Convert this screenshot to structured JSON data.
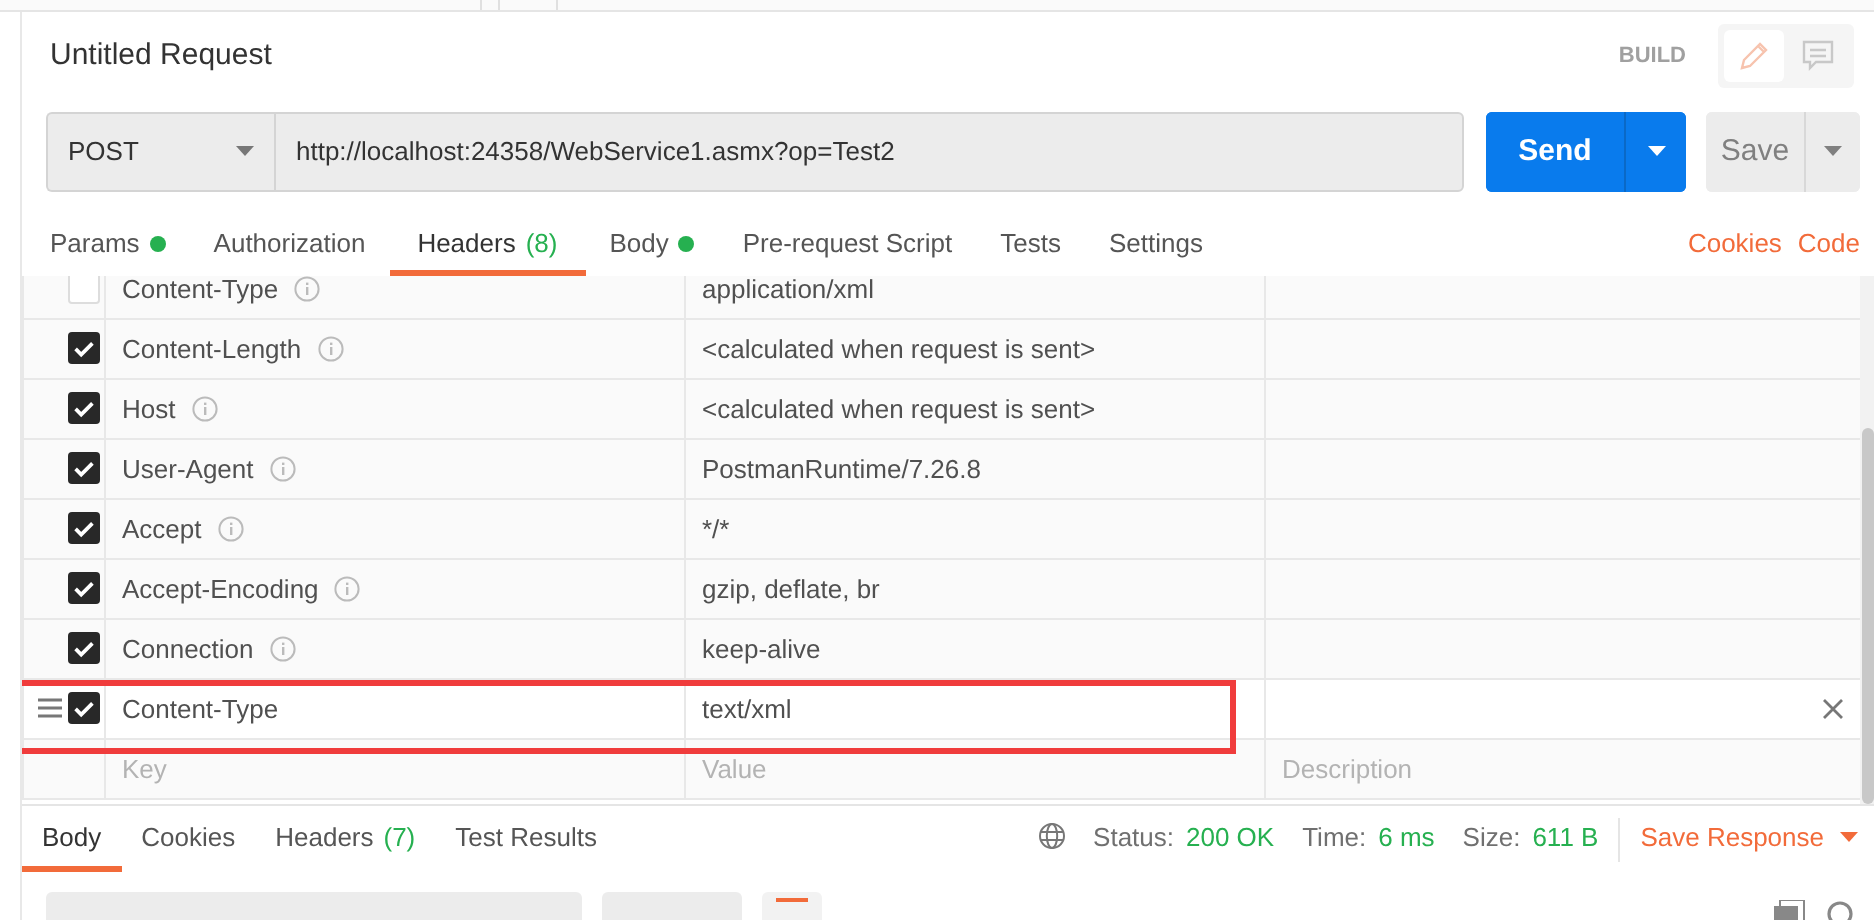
{
  "title": "Untitled Request",
  "mode": "BUILD",
  "request": {
    "method": "POST",
    "url": "http://localhost:24358/WebService1.asmx?op=Test2",
    "send": "Send",
    "save": "Save"
  },
  "tabs": [
    {
      "label": "Params",
      "dot": true,
      "selected": false
    },
    {
      "label": "Authorization",
      "dot": false,
      "selected": false
    },
    {
      "label": "Headers",
      "count": "(8)",
      "dot": false,
      "selected": true
    },
    {
      "label": "Body",
      "dot": true,
      "selected": false
    },
    {
      "label": "Pre-request Script",
      "dot": false,
      "selected": false
    },
    {
      "label": "Tests",
      "dot": false,
      "selected": false
    },
    {
      "label": "Settings",
      "dot": false,
      "selected": false
    }
  ],
  "links": [
    "Cookies",
    "Code"
  ],
  "headers": [
    {
      "key": "Content-Type",
      "value": "application/xml",
      "checked": false,
      "info": true,
      "hovered": false,
      "annotated": false
    },
    {
      "key": "Content-Length",
      "value": "<calculated when request is sent>",
      "checked": true,
      "info": true,
      "hovered": false,
      "annotated": false
    },
    {
      "key": "Host",
      "value": "<calculated when request is sent>",
      "checked": true,
      "info": true,
      "hovered": false,
      "annotated": false
    },
    {
      "key": "User-Agent",
      "value": "PostmanRuntime/7.26.8",
      "checked": true,
      "info": true,
      "hovered": false,
      "annotated": false
    },
    {
      "key": "Accept",
      "value": "*/*",
      "checked": true,
      "info": true,
      "hovered": false,
      "annotated": false
    },
    {
      "key": "Accept-Encoding",
      "value": "gzip, deflate, br",
      "checked": true,
      "info": true,
      "hovered": false,
      "annotated": false
    },
    {
      "key": "Connection",
      "value": "keep-alive",
      "checked": true,
      "info": true,
      "hovered": false,
      "annotated": false
    },
    {
      "key": "Content-Type",
      "value": "text/xml",
      "checked": true,
      "info": false,
      "hovered": true,
      "annotated": true
    }
  ],
  "new_row": {
    "key_placeholder": "Key",
    "value_placeholder": "Value",
    "description_placeholder": "Description"
  },
  "response": {
    "tabs": [
      {
        "label": "Body",
        "selected": true
      },
      {
        "label": "Cookies",
        "selected": false
      },
      {
        "label": "Headers",
        "count": "(7)",
        "selected": false
      },
      {
        "label": "Test Results",
        "selected": false
      }
    ],
    "status_label": "Status:",
    "status": "200 OK",
    "time_label": "Time:",
    "time": "6 ms",
    "size_label": "Size:",
    "size": "611 B",
    "save": "Save Response"
  }
}
